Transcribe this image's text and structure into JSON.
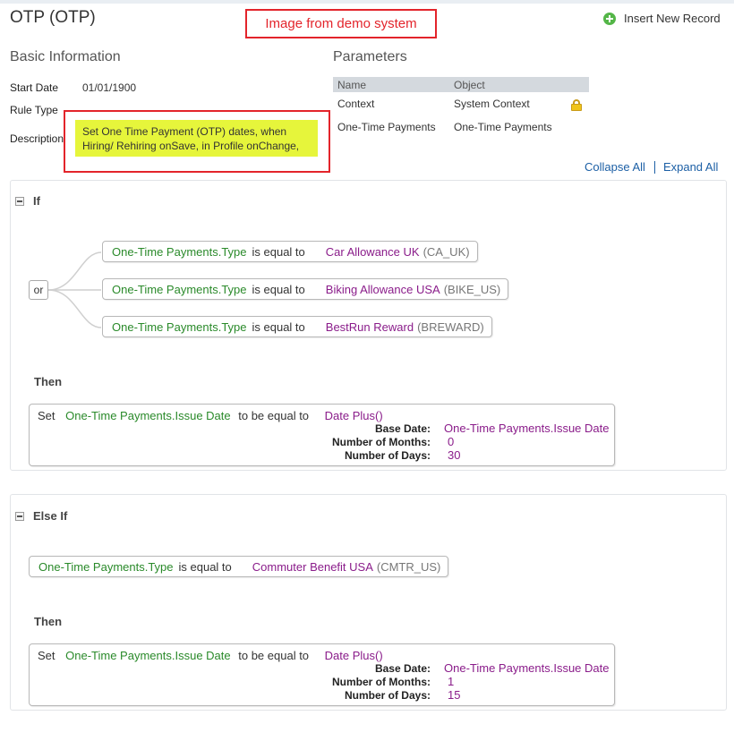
{
  "header": {
    "title": "OTP (OTP)",
    "banner": "Image from demo system",
    "insert_label": "Insert New Record"
  },
  "basic": {
    "heading": "Basic Information",
    "start_date_label": "Start Date",
    "start_date_value": "01/01/1900",
    "rule_type_label": "Rule Type",
    "description_label": "Description",
    "description_value": "Set  One Time Payment (OTP) dates, when Hiring/ Rehiring onSave, in Profile onChange,"
  },
  "parameters": {
    "heading": "Parameters",
    "col_name": "Name",
    "col_object": "Object",
    "rows": [
      {
        "name": "Context",
        "object": "System Context",
        "locked": true
      },
      {
        "name": "One-Time Payments",
        "object": "One-Time Payments",
        "locked": false
      }
    ]
  },
  "links": {
    "collapse_all": "Collapse All",
    "expand_all": "Expand All"
  },
  "if_block": {
    "keyword": "If",
    "operator": "or",
    "conditions": [
      {
        "field": "One-Time Payments.Type",
        "op": "is equal to",
        "value": "Car Allowance UK",
        "code": "(CA_UK)"
      },
      {
        "field": "One-Time Payments.Type",
        "op": "is equal to",
        "value": "Biking Allowance USA",
        "code": "(BIKE_US)"
      },
      {
        "field": "One-Time Payments.Type",
        "op": "is equal to",
        "value": "BestRun Reward",
        "code": "(BREWARD)"
      }
    ],
    "then_keyword": "Then",
    "action": {
      "set": "Set",
      "field": "One-Time Payments.Issue Date",
      "op": "to be equal to",
      "func": "Date Plus()",
      "args": [
        {
          "label": "Base Date:",
          "value": "One-Time Payments.Issue Date"
        },
        {
          "label": "Number of Months:",
          "value": "0"
        },
        {
          "label": "Number of Days:",
          "value": "30"
        }
      ]
    }
  },
  "elseif_block": {
    "keyword": "Else If",
    "condition": {
      "field": "One-Time Payments.Type",
      "op": "is equal to",
      "value": "Commuter Benefit USA",
      "code": "(CMTR_US)"
    },
    "then_keyword": "Then",
    "action": {
      "set": "Set",
      "field": "One-Time Payments.Issue Date",
      "op": "to be equal to",
      "func": "Date Plus()",
      "args": [
        {
          "label": "Base Date:",
          "value": "One-Time Payments.Issue Date"
        },
        {
          "label": "Number of Months:",
          "value": "1"
        },
        {
          "label": "Number of Days:",
          "value": "15"
        }
      ]
    }
  }
}
